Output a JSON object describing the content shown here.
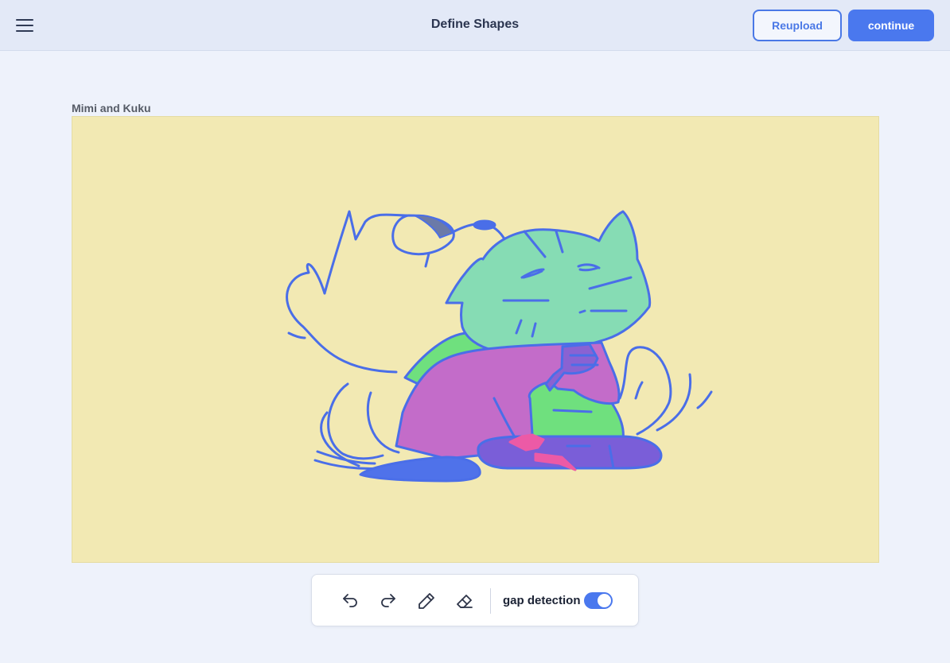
{
  "header": {
    "title": "Define Shapes",
    "reupload_label": "Reupload",
    "continue_label": "continue",
    "menu_icon": "hamburger-menu-icon"
  },
  "canvas": {
    "label": "Mimi and Kuku",
    "background": "#f2e9b3",
    "stroke_color": "#4a6ee8"
  },
  "toolbar": {
    "tools": [
      "undo-icon",
      "redo-icon",
      "pencil-icon",
      "eraser-icon"
    ],
    "gap_detection_label": "gap detection",
    "gap_detection_enabled": true
  },
  "colors": {
    "accent": "#4a78ee",
    "topbar": "#e3e9f7",
    "page_bg": "#eef2fb",
    "fill_green_light": "#86dcb4",
    "fill_green": "#6fe07e",
    "fill_purple": "#c36cc9",
    "fill_blue": "#5a7bea",
    "fill_pink": "#ec5aa6"
  }
}
